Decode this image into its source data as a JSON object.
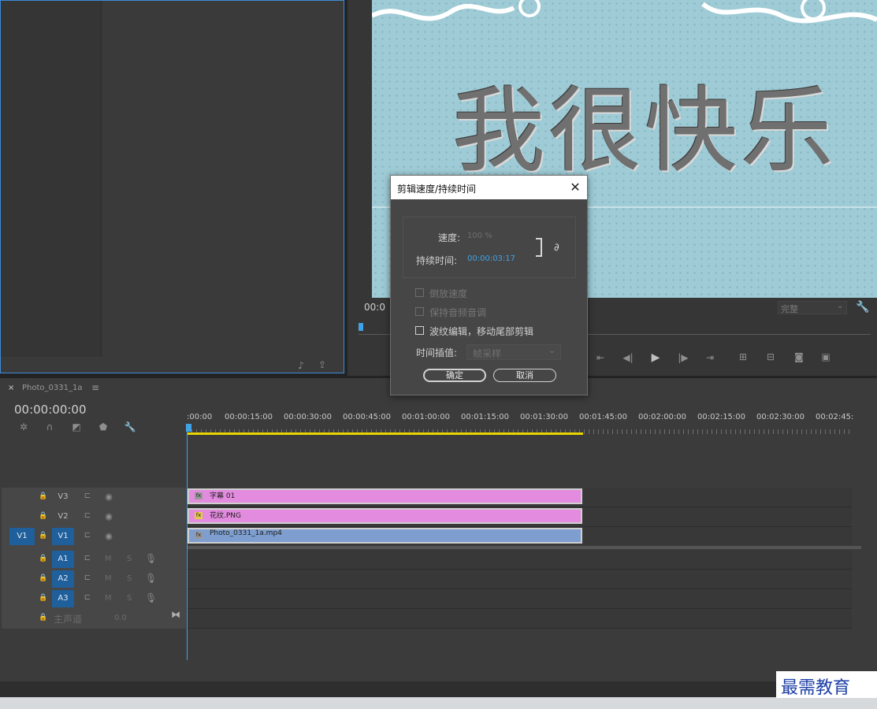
{
  "source_panel": {},
  "program": {
    "video_text": "我很快乐",
    "timecode": "00:0",
    "fit_select": "完整"
  },
  "timeline": {
    "tab_name": "Photo_0331_1a",
    "timecode": "00:00:00:00",
    "ruler_labels": [
      ":00:00",
      "00:00:15:00",
      "00:00:30:00",
      "00:00:45:00",
      "00:01:00:00",
      "00:01:15:00",
      "00:01:30:00",
      "00:01:45:00",
      "00:02:00:00",
      "00:02:15:00",
      "00:02:30:00",
      "00:02:45:"
    ],
    "tracks": {
      "v3": "V3",
      "v2": "V2",
      "v1": "V1",
      "src_v1": "V1",
      "a1": "A1",
      "a2": "A2",
      "a3": "A3",
      "m": "M",
      "s": "S",
      "master": "主声道",
      "master_level": "0.0"
    },
    "clips": {
      "title": "字幕 01",
      "flower": "花纹.PNG",
      "video": "Photo_0331_1a.mp4",
      "fx": "fx"
    }
  },
  "dialog": {
    "title": "剪辑速度/持续时间",
    "speed_label": "速度:",
    "speed_value": "100 %",
    "duration_label": "持续时间:",
    "duration_value": "00:00:03:17",
    "reverse_label": "倒放速度",
    "pitch_label": "保持音频音调",
    "ripple_label": "波纹编辑，移动尾部剪辑",
    "interp_label": "时间插值:",
    "interp_value": "帧采样",
    "ok_label": "确定",
    "cancel_label": "取消"
  },
  "watermark": {
    "text": "最需教育"
  },
  "colors": {
    "accent_blue": "#3d8bd6",
    "track_blue": "#1f5f9b",
    "title_clip": "#e38bdf",
    "video_clip": "#7d9ecf",
    "work_area": "#e8d400",
    "timecode_blue": "#3fa3e6"
  }
}
